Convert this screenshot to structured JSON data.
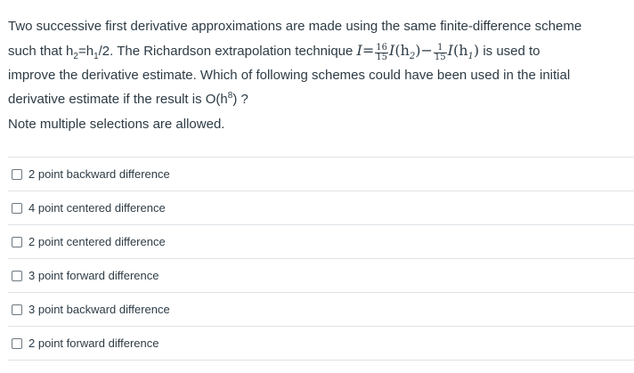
{
  "question": {
    "line1": "Two successive first derivative approximations are made using the same finite-difference scheme",
    "line2_pre": "such that h",
    "h2_sub": "2",
    "eq_h1": "=h",
    "h1_sub": "1",
    "line2_mid": "/2. The Richardson extrapolation technique ",
    "formula": {
      "I": "I",
      "eq": "=",
      "frac1_num": "16",
      "frac1_den": "15",
      "term1": "(h",
      "term1_sub": "2",
      "close": ")",
      "minus": "−",
      "frac2_num": "1",
      "frac2_den": "15",
      "term2": "(h",
      "term2_sub": "1"
    },
    "line2_post": " is used to",
    "line3": "improve the derivative estimate. Which of following schemes could have been used in the initial",
    "line4_pre": "derivative estimate if the result is O(h",
    "line4_sup": "8",
    "line4_post": ") ?"
  },
  "note": "Note multiple selections are allowed.",
  "answers": [
    {
      "label": "2 point backward difference",
      "checked": false
    },
    {
      "label": "4 point centered difference",
      "checked": false
    },
    {
      "label": "2 point centered difference",
      "checked": false
    },
    {
      "label": "3 point forward difference",
      "checked": false
    },
    {
      "label": "3 point backward difference",
      "checked": false
    },
    {
      "label": "2 point forward difference",
      "checked": false
    }
  ]
}
